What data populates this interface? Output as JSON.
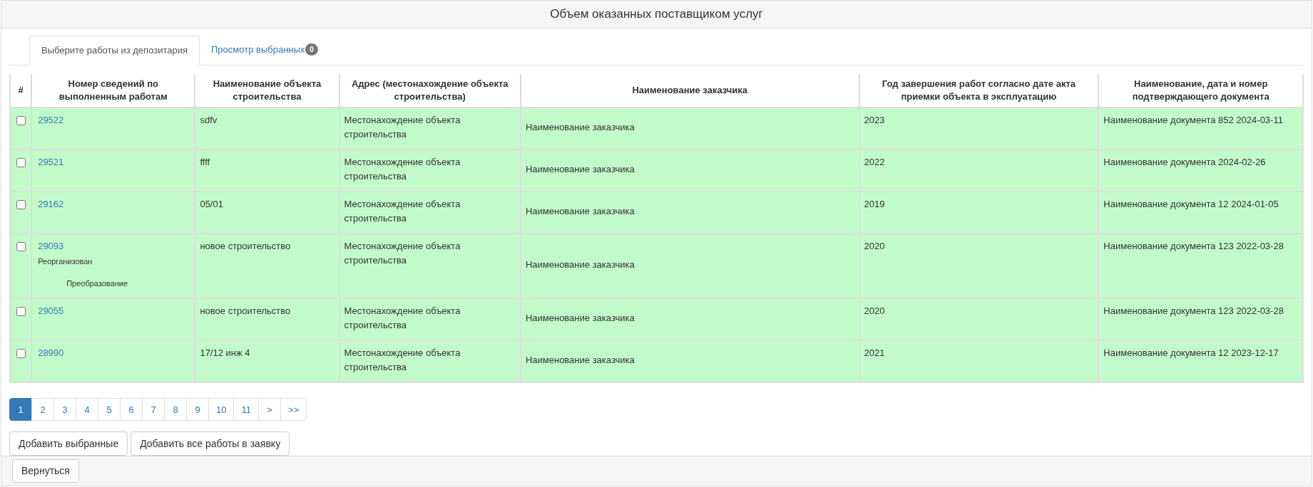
{
  "header": {
    "title": "Объем оказанных поставщиком услуг"
  },
  "tabs": [
    {
      "label": "Выберите работы из депозитария",
      "selected": true
    },
    {
      "label": "Просмотр выбранных",
      "selected": false,
      "badge": "0"
    }
  ],
  "table": {
    "columns": [
      "#",
      "Номер сведений по выполненным работам",
      "Наименование объекта строительства",
      "Адрес (местонахождение объекта строительства)",
      "Наименование заказчика",
      "Год завершения работ согласно дате акта приемки объекта в эксплуатацию",
      "Наименование, дата и номер подтверждающего документа"
    ],
    "rows": [
      {
        "checked": false,
        "number": "29522",
        "notes": [],
        "object": "sdfv",
        "address": "Местонахождение объекта строительства",
        "customer": "Наименование заказчика",
        "year": "2023",
        "document": "Наименование документа 852 2024-03-11"
      },
      {
        "checked": false,
        "number": "29521",
        "notes": [],
        "object": "ffff",
        "address": "Местонахождение объекта строительства",
        "customer": "Наименование заказчика",
        "year": "2022",
        "document": "Наименование документа 2024-02-26"
      },
      {
        "checked": false,
        "number": "29162",
        "notes": [],
        "object": "05/01",
        "address": "Местонахождение объекта строительства",
        "customer": "Наименование заказчика",
        "year": "2019",
        "document": "Наименование документа 12 2024-01-05"
      },
      {
        "checked": false,
        "number": "29093",
        "notes": [
          "Реорганизован",
          "Преобразование"
        ],
        "object": "новое строительство",
        "address": "Местонахождение объекта строительства",
        "customer": "Наименование заказчика",
        "year": "2020",
        "document": "Наименование документа 123 2022-03-28"
      },
      {
        "checked": false,
        "number": "29055",
        "notes": [],
        "object": "новое строительство",
        "address": "Местонахождение объекта строительства",
        "customer": "Наименование заказчика",
        "year": "2020",
        "document": "Наименование документа 123 2022-03-28"
      },
      {
        "checked": false,
        "number": "28990",
        "notes": [],
        "object": "17/12 инж 4",
        "address": "Местонахождение объекта строительства",
        "customer": "Наименование заказчика",
        "year": "2021",
        "document": "Наименование документа 12 2023-12-17"
      }
    ]
  },
  "pagination": [
    {
      "label": "1",
      "selected": true
    },
    {
      "label": "2",
      "selected": false
    },
    {
      "label": "3",
      "selected": false
    },
    {
      "label": "4",
      "selected": false
    },
    {
      "label": "5",
      "selected": false
    },
    {
      "label": "6",
      "selected": false
    },
    {
      "label": "7",
      "selected": false
    },
    {
      "label": "8",
      "selected": false
    },
    {
      "label": "9",
      "selected": false
    },
    {
      "label": "10",
      "selected": false
    },
    {
      "label": "11",
      "selected": false
    },
    {
      "label": ">",
      "selected": false
    },
    {
      "label": ">>",
      "selected": false
    }
  ],
  "buttons": [
    "Добавить выбранные",
    "Добавить все работы в заявку"
  ],
  "footer": {
    "button": "Вернуться"
  }
}
